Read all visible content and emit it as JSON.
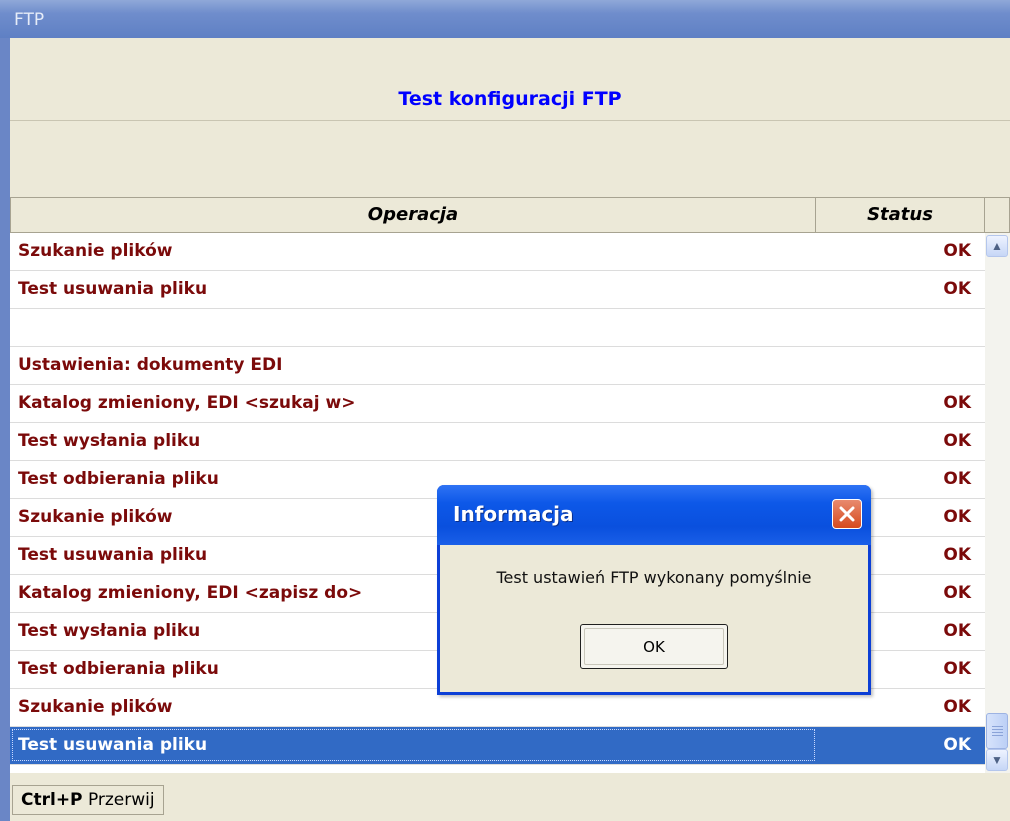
{
  "window": {
    "title": "FTP",
    "heading": "Test konfiguracji FTP"
  },
  "grid": {
    "columns": {
      "operation": "Operacja",
      "status": "Status"
    },
    "rows": [
      {
        "op": "Szukanie plików",
        "status": "OK"
      },
      {
        "op": "Test usuwania pliku",
        "status": "OK"
      },
      {
        "op": "",
        "status": ""
      },
      {
        "op": "Ustawienia: dokumenty EDI",
        "status": ""
      },
      {
        "op": "Katalog zmieniony, EDI <szukaj w>",
        "status": "OK"
      },
      {
        "op": "Test wysłania pliku",
        "status": "OK"
      },
      {
        "op": "Test odbierania pliku",
        "status": "OK"
      },
      {
        "op": "Szukanie plików",
        "status": "OK"
      },
      {
        "op": "Test usuwania pliku",
        "status": "OK"
      },
      {
        "op": "Katalog zmieniony, EDI <zapisz do>",
        "status": "OK"
      },
      {
        "op": "Test wysłania pliku",
        "status": "OK"
      },
      {
        "op": "Test odbierania pliku",
        "status": "OK"
      },
      {
        "op": "Szukanie plików",
        "status": "OK"
      },
      {
        "op": "Test usuwania pliku",
        "status": "OK"
      }
    ],
    "selected_row_index": 13
  },
  "footer": {
    "shortcut": "Ctrl+P",
    "action": "Przerwij"
  },
  "dialog": {
    "title": "Informacja",
    "message": "Test ustawień FTP wykonany pomyślnie",
    "ok_label": "OK"
  },
  "colors": {
    "row_text": "#7b0a0a",
    "heading": "#0000ff",
    "selection": "#316ac5",
    "dialog_title": "#0a50de"
  }
}
